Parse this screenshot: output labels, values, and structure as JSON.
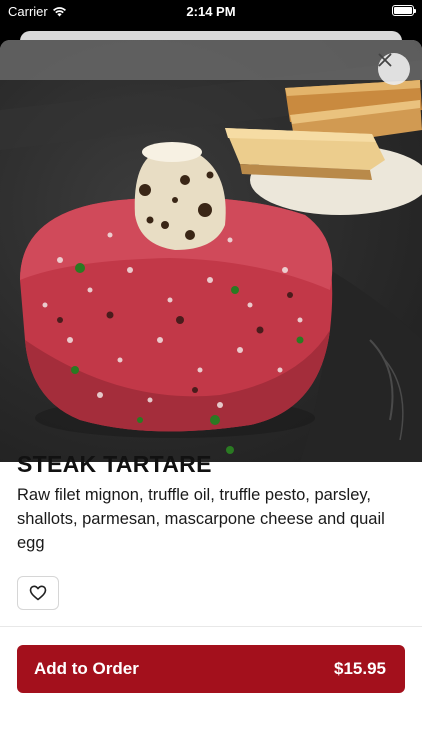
{
  "status_bar": {
    "carrier": "Carrier",
    "time": "2:14 PM"
  },
  "item": {
    "title": "STEAK TARTARE",
    "description": "Raw filet mignon, truffle oil, truffle pesto, parsley, shallots, parmesan, mascarpone cheese and quail egg",
    "image_icon": "steak-tartare-photo"
  },
  "actions": {
    "close_icon": "close-icon",
    "favorite_icon": "heart-outline-icon",
    "add_label": "Add to Order",
    "price": "$15.95"
  },
  "colors": {
    "brand": "#a3101c",
    "text": "#111111",
    "surface": "#ffffff"
  }
}
